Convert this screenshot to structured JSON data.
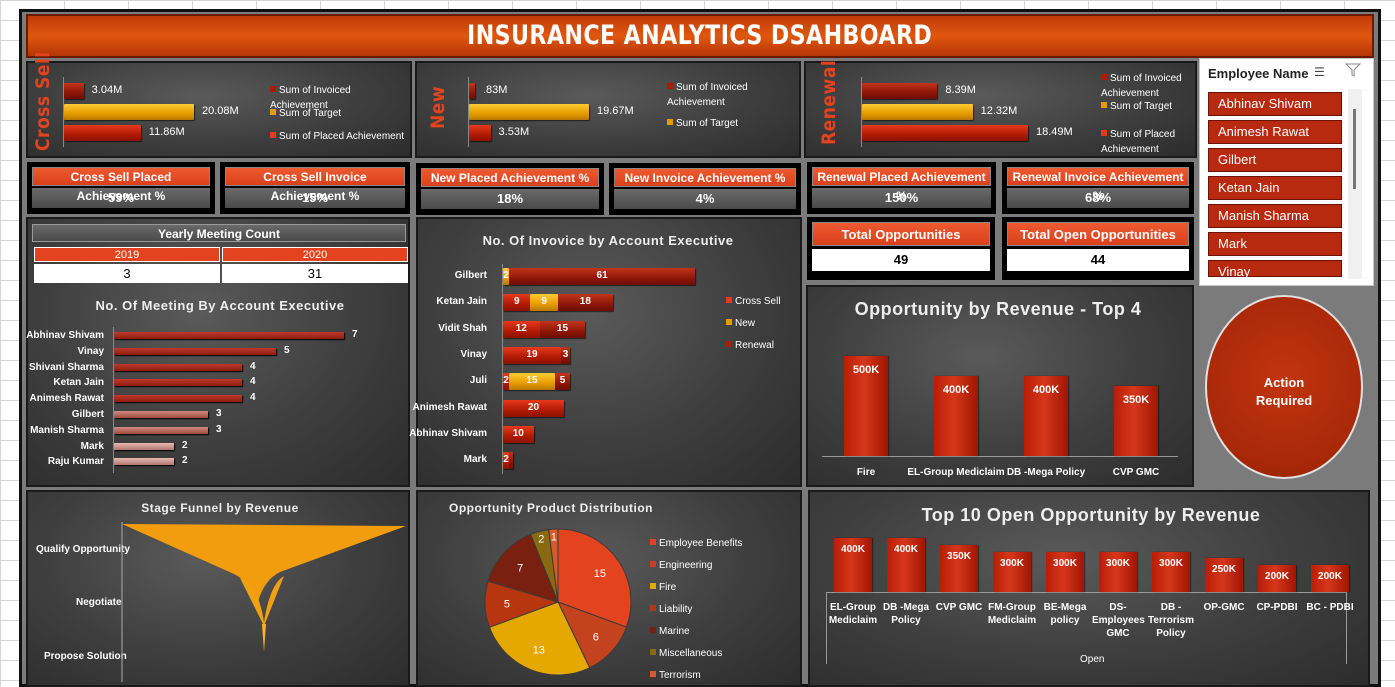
{
  "title": "INSURANCE ANALYTICS DSAHBOARD",
  "cross_sell": {
    "label": "Cross Sell",
    "bars": [
      {
        "value": 3.04,
        "label": "3.04M",
        "color": "#b01a05"
      },
      {
        "value": 20.08,
        "label": "20.08M",
        "color": "#e59c00"
      },
      {
        "value": 11.86,
        "label": "11.86M",
        "color": "#e8391c"
      }
    ],
    "legend": [
      "Sum of Invoiced Achievement",
      "Sum of Target",
      "Sum of Placed Achievement"
    ]
  },
  "new": {
    "label": "New",
    "bars": [
      {
        "value": 0.83,
        "label": ".83M",
        "color": "#b01a05"
      },
      {
        "value": 19.67,
        "label": "19.67M",
        "color": "#e59c00"
      },
      {
        "value": 3.53,
        "label": "3.53M",
        "color": "#e8391c"
      }
    ],
    "legend": [
      "Sum of Invoiced Achievement",
      "Sum of Target"
    ]
  },
  "renewal": {
    "label": "Renewal",
    "bars": [
      {
        "value": 8.39,
        "label": "8.39M",
        "color": "#b01a05"
      },
      {
        "value": 12.32,
        "label": "12.32M",
        "color": "#e59c00"
      },
      {
        "value": 18.49,
        "label": "18.49M",
        "color": "#e8391c"
      }
    ],
    "legend": [
      "Sum of Invoiced Achievement",
      "Sum of Target",
      "Sum of Placed Achievement"
    ]
  },
  "kpis": [
    {
      "title": "Cross Sell Placed Achievement %",
      "value": "59%"
    },
    {
      "title": "Cross Sell Invoice Achievement %",
      "value": "15%"
    },
    {
      "title": "New Placed Achievement %",
      "value": "18%"
    },
    {
      "title": "New Invoice Achievement %",
      "value": "4%"
    },
    {
      "title": "Renewal Placed Achievement %",
      "value": "150%"
    },
    {
      "title": "Renewal Invoice Achievement %",
      "value": "68%"
    }
  ],
  "meeting_count": {
    "title": "Yearly Meeting Count",
    "years": [
      "2019",
      "2020"
    ],
    "counts": [
      "3",
      "31"
    ]
  },
  "meetings_by_exec": {
    "title": "No. Of Meeting By Account Executive",
    "rows": [
      {
        "name": "Abhinav Shivam",
        "value": 7
      },
      {
        "name": "Vinay",
        "value": 5
      },
      {
        "name": "Shivani Sharma",
        "value": 4
      },
      {
        "name": "Ketan Jain",
        "value": 4
      },
      {
        "name": "Animesh Rawat",
        "value": 4
      },
      {
        "name": "Gilbert",
        "value": 3
      },
      {
        "name": "Manish Sharma",
        "value": 3
      },
      {
        "name": "Mark",
        "value": 2
      },
      {
        "name": "Raju Kumar",
        "value": 2
      }
    ]
  },
  "invoice_by_exec": {
    "title": "No. Of Invovice by Account Executive",
    "legend": [
      "Cross Sell",
      "New",
      "Renewal"
    ],
    "rows": [
      {
        "name": "Gilbert",
        "cross": 0,
        "new": 2,
        "renewal": 61,
        "labels": [
          "",
          "2",
          "61"
        ]
      },
      {
        "name": "Ketan Jain",
        "cross": 9,
        "new": 9,
        "renewal": 18,
        "labels": [
          "9",
          "9",
          "18"
        ]
      },
      {
        "name": "Vidit Shah",
        "cross": 12,
        "new": 0,
        "renewal": 15,
        "labels": [
          "12",
          "",
          "15"
        ]
      },
      {
        "name": "Vinay",
        "cross": 19,
        "new": 0,
        "renewal": 3,
        "labels": [
          "19",
          "",
          "3"
        ]
      },
      {
        "name": "Juli",
        "cross": 2,
        "new": 15,
        "renewal": 5,
        "labels": [
          "2",
          "15",
          "5"
        ]
      },
      {
        "name": "Animesh Rawat",
        "cross": 20,
        "new": 0,
        "renewal": 0,
        "labels": [
          "20",
          "",
          ""
        ]
      },
      {
        "name": "Abhinav Shivam",
        "cross": 10,
        "new": 0,
        "renewal": 0,
        "labels": [
          "10",
          "",
          ""
        ]
      },
      {
        "name": "Mark",
        "cross": 2,
        "new": 0,
        "renewal": 1,
        "labels": [
          "2",
          "",
          ""
        ]
      }
    ]
  },
  "totals": [
    {
      "title": "Total Opportunities",
      "value": "49"
    },
    {
      "title": "Total Open Opportunities",
      "value": "44"
    }
  ],
  "opp_by_revenue": {
    "title": "Opportunity by Revenue - Top 4",
    "bars": [
      {
        "name": "Fire",
        "value": 500,
        "label": "500K"
      },
      {
        "name": "EL-Group Mediclaim",
        "value": 400,
        "label": "400K"
      },
      {
        "name": "DB -Mega Policy",
        "value": 400,
        "label": "400K"
      },
      {
        "name": "CVP GMC",
        "value": 350,
        "label": "350K"
      }
    ]
  },
  "slicer": {
    "title": "Employee Name",
    "items": [
      "Abhinav Shivam",
      "Animesh Rawat",
      "Gilbert",
      "Ketan Jain",
      "Manish Sharma",
      "Mark",
      "Vinay"
    ]
  },
  "action": {
    "label_line1": "Action",
    "label_line2": "Required"
  },
  "stage_funnel": {
    "title": "Stage Funnel by Revenue",
    "stages": [
      "Qualify Opportunity",
      "Negotiate",
      "Propose Solution"
    ]
  },
  "product_dist": {
    "title": "Opportunity Product Distribution",
    "slices": [
      {
        "name": "Employee Benefits",
        "value": 15,
        "color": "#e3431e"
      },
      {
        "name": "Engineering",
        "value": 6,
        "color": "#c4431f"
      },
      {
        "name": "Fire",
        "value": 13,
        "color": "#e5a800"
      },
      {
        "name": "Liability",
        "value": 5,
        "color": "#b8360f"
      },
      {
        "name": "Marine",
        "value": 7,
        "color": "#7a2010"
      },
      {
        "name": "Miscellaneous",
        "value": 2,
        "color": "#8a6a10"
      },
      {
        "name": "Terrorism",
        "value": 1,
        "color": "#d65a2a"
      }
    ]
  },
  "top10": {
    "title": "Top 10 Open Opportunity by Revenue",
    "axis_label": "Open",
    "bars": [
      {
        "name": "EL-Group Mediclaim",
        "value": 400,
        "label": "400K"
      },
      {
        "name": "DB -Mega Policy",
        "value": 400,
        "label": "400K"
      },
      {
        "name": "CVP GMC",
        "value": 350,
        "label": "350K"
      },
      {
        "name": "FM-Group Mediclaim",
        "value": 300,
        "label": "300K"
      },
      {
        "name": "BE-Mega policy",
        "value": 300,
        "label": "300K"
      },
      {
        "name": "DS-Employees GMC",
        "value": 300,
        "label": "300K"
      },
      {
        "name": "DB - Terrorism Policy",
        "value": 300,
        "label": "300K"
      },
      {
        "name": "OP-GMC",
        "value": 250,
        "label": "250K"
      },
      {
        "name": "CP-PDBI",
        "value": 200,
        "label": "200K"
      },
      {
        "name": "BC - PDBI",
        "value": 200,
        "label": "200K"
      }
    ]
  }
}
